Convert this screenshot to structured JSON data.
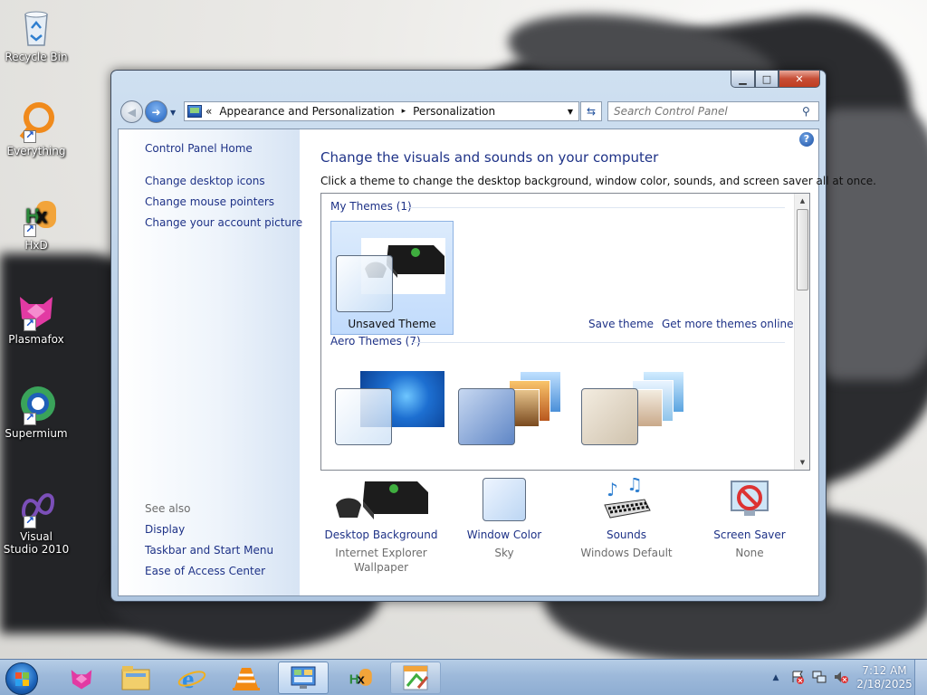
{
  "desktop": {
    "icons": [
      {
        "label": "Recycle Bin"
      },
      {
        "label": "Everything"
      },
      {
        "label": "HxD"
      },
      {
        "label": "Plasmafox"
      },
      {
        "label": "Supermium"
      },
      {
        "label": "Visual Studio 2010"
      }
    ]
  },
  "window": {
    "caption_buttons": {
      "minimize": "▁",
      "maximize": "□",
      "close": "✕"
    },
    "address": {
      "prefix": "«",
      "crumbs": [
        "Appearance and Personalization",
        "Personalization"
      ],
      "separator": "▸"
    },
    "search": {
      "placeholder": "Search Control Panel"
    }
  },
  "left_pane": {
    "home": "Control Panel Home",
    "links": [
      "Change desktop icons",
      "Change mouse pointers",
      "Change your account picture"
    ],
    "see_also_label": "See also",
    "see_also": [
      "Display",
      "Taskbar and Start Menu",
      "Ease of Access Center"
    ]
  },
  "main": {
    "help": "?",
    "title": "Change the visuals and sounds on your computer",
    "subtitle": "Click a theme to change the desktop background, window color, sounds, and screen saver all at once.",
    "my_themes": {
      "header": "My Themes (1)",
      "items": [
        {
          "label": "Unsaved Theme",
          "selected": true
        }
      ]
    },
    "save_theme": "Save theme",
    "get_more": "Get more themes online",
    "aero_themes": {
      "header": "Aero Themes (7)"
    },
    "settings": [
      {
        "link": "Desktop Background",
        "value": "Internet Explorer",
        "value2": "Wallpaper",
        "icon": "xbox-console-icon"
      },
      {
        "link": "Window Color",
        "value": "Sky",
        "value2": "",
        "icon": "window-color-icon"
      },
      {
        "link": "Sounds",
        "value": "Windows Default",
        "value2": "",
        "icon": "sounds-icon"
      },
      {
        "link": "Screen Saver",
        "value": "None",
        "value2": "",
        "icon": "screen-saver-icon"
      }
    ]
  },
  "taskbar": {
    "clock": {
      "time": "7:12 AM",
      "date": "2/18/2025"
    },
    "pinned": [
      "plasmafox-icon",
      "explorer-icon",
      "internet-explorer-icon",
      "vlc-icon",
      "control-panel-icon",
      "hxd-icon",
      "paint-icon"
    ],
    "tray_arrow": "▲"
  }
}
